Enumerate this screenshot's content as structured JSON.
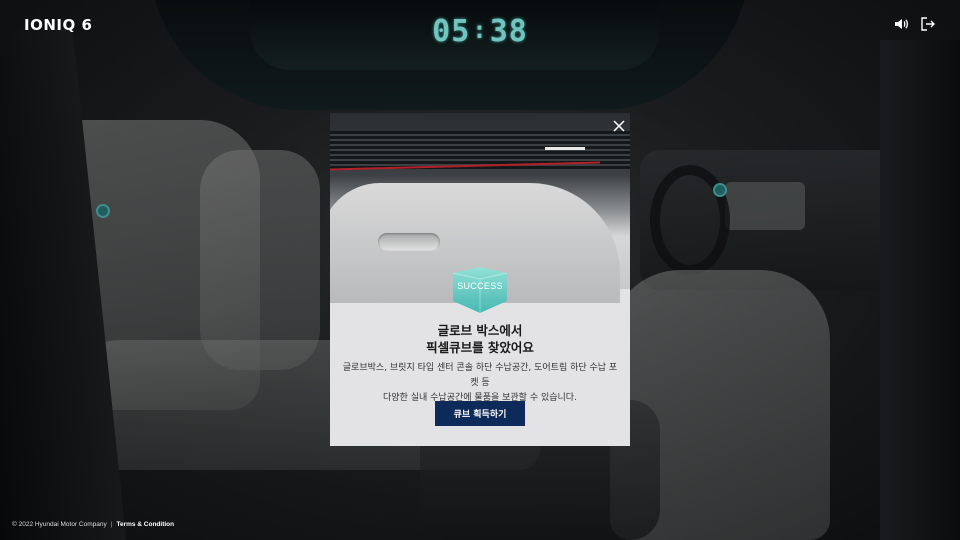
{
  "header": {
    "logo": "IONIQ 6",
    "timer_minutes": "05",
    "timer_seconds": "38"
  },
  "icons": {
    "sound": "speaker-icon",
    "exit": "exit-icon",
    "close": "close-icon",
    "badge": "success-cube-icon"
  },
  "modal": {
    "badge_text": "SUCCESS",
    "title_line1": "글로브 박스에서",
    "title_line2": "픽셀큐브를 찾았어요",
    "desc_line1": "글로브박스, 브릿지 타입 센터 콘솔 하단 수납공간, 도어트림 하단 수납 포켓 등",
    "desc_line2": "다양한 실내 수납공간에 물품을 보관할 수 있습니다.",
    "button_label": "큐브 획득하기"
  },
  "footer": {
    "copyright": "© 2022 Hyundai Motor Company",
    "separator": "|",
    "terms": "Terms & Condition"
  },
  "colors": {
    "timer": "#7fd8d2",
    "button": "#0e2a5a",
    "modal_bg": "#e3e3e5",
    "badge": "#5cc9c3"
  }
}
